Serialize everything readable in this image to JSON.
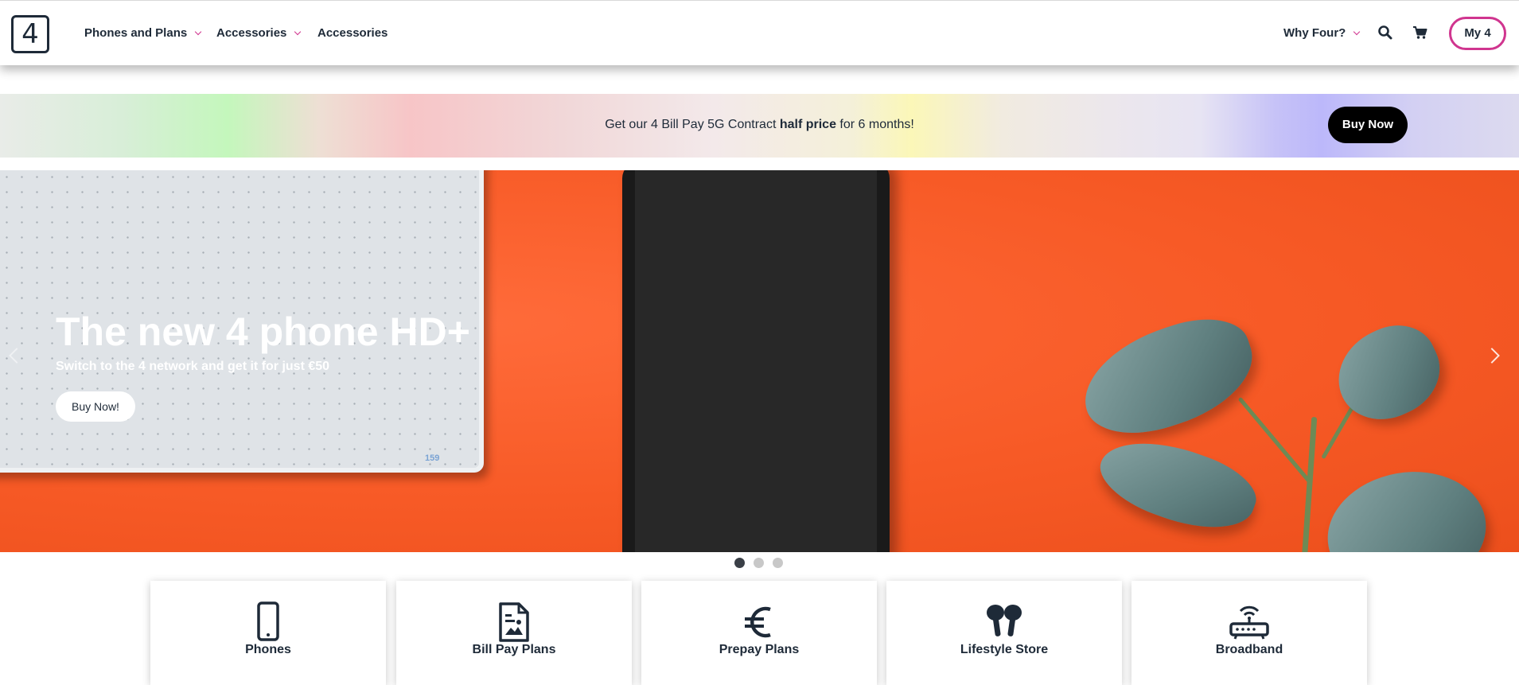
{
  "header": {
    "logo_text": "4",
    "nav": [
      {
        "label": "Phones and Plans",
        "has_dropdown": true
      },
      {
        "label": "Accessories",
        "has_dropdown": true
      },
      {
        "label": "Accessories",
        "has_dropdown": false
      }
    ],
    "why_four": "Why Four?",
    "search_icon": "search-icon",
    "cart_icon": "cart-icon",
    "my4_label": "My 4"
  },
  "promo": {
    "text_before": "Get our 4 Bill Pay 5G Contract ",
    "text_bold": "half price",
    "text_after": " for 6 months!",
    "button_label": "Buy Now"
  },
  "hero": {
    "title": "The new 4 phone HD+",
    "subtitle": "Switch to the 4 network and get it for just €50",
    "button_label": "Buy Now!",
    "notebook_number": "159",
    "prev_icon": "chevron-left-icon",
    "next_icon": "chevron-right-icon"
  },
  "carousel": {
    "slides": 3,
    "active_index": 0
  },
  "categories": [
    {
      "label": "Phones",
      "icon": "phone-icon"
    },
    {
      "label": "Bill Pay Plans",
      "icon": "document-icon"
    },
    {
      "label": "Prepay Plans",
      "icon": "euro-icon"
    },
    {
      "label": "Lifestyle Store",
      "icon": "earbuds-icon"
    },
    {
      "label": "Broadband",
      "icon": "router-icon"
    }
  ],
  "colors": {
    "brand_pink": "#d0358f",
    "text_dark": "#1e2a38",
    "hero_orange": "#f75a26",
    "button_black": "#000000"
  }
}
